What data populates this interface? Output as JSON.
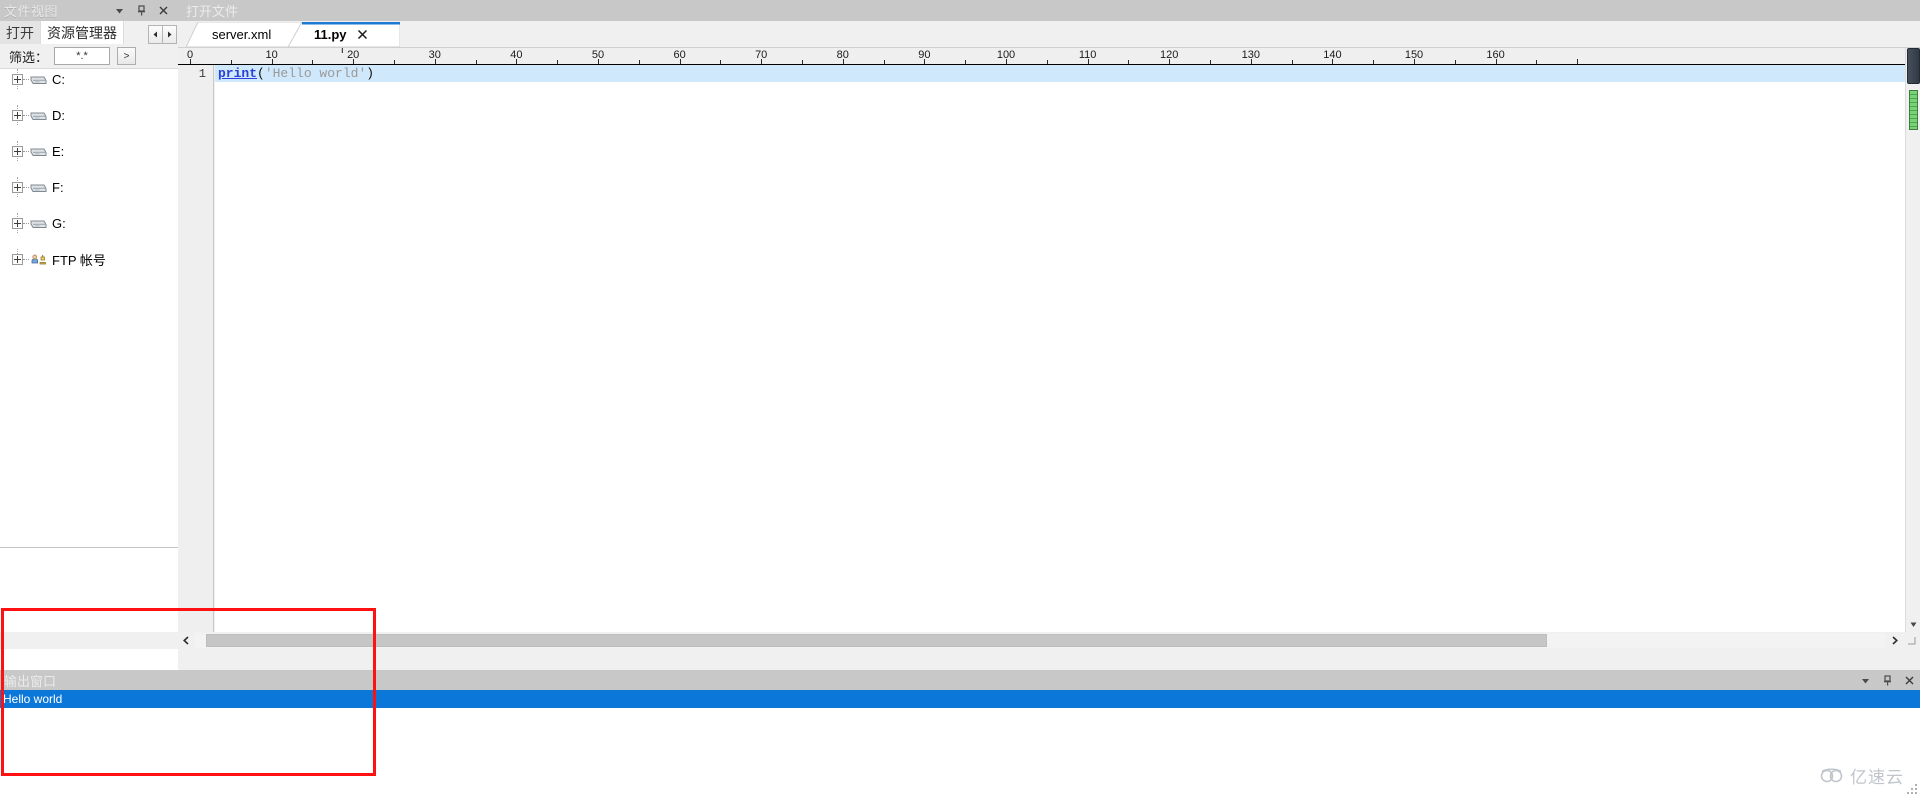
{
  "left_panel": {
    "caption": {
      "title": "文件视图",
      "buttons": [
        {
          "name": "dropdown",
          "label": "▾"
        },
        {
          "name": "pin",
          "label": "pin"
        },
        {
          "name": "close",
          "label": "✕"
        }
      ]
    },
    "tabs": [
      {
        "id": "open",
        "label": "打开",
        "active": false
      },
      {
        "id": "explorer",
        "label": "资源管理器",
        "active": true
      }
    ],
    "tab_nav": {
      "prev": "◄",
      "next": "►"
    },
    "filter": {
      "label": "筛选：",
      "value": "*.*",
      "placeholder": "*.*",
      "go_label": ">"
    },
    "tree": [
      {
        "label": "C:",
        "icon": "drive-icon",
        "expandable": true
      },
      {
        "label": "D:",
        "icon": "drive-icon",
        "expandable": true
      },
      {
        "label": "E:",
        "icon": "drive-icon",
        "expandable": true
      },
      {
        "label": "F:",
        "icon": "drive-icon",
        "expandable": true
      },
      {
        "label": "G:",
        "icon": "drive-icon",
        "expandable": true
      },
      {
        "label": "FTP 帐号",
        "icon": "ftp-account-icon",
        "expandable": true
      }
    ]
  },
  "editor": {
    "caption": {
      "title": "打开文件"
    },
    "tabs": [
      {
        "id": "server-xml",
        "label": "server.xml",
        "active": false,
        "closable": false
      },
      {
        "id": "11-py",
        "label": "11.py",
        "active": true,
        "closable": true,
        "close_label": "✕"
      }
    ],
    "ruler": {
      "labels": [
        "0",
        "10",
        "20",
        "30",
        "40",
        "50",
        "60",
        "70",
        "80",
        "90",
        "100",
        "110",
        "120",
        "130",
        "140",
        "150",
        "160"
      ],
      "tab_stop_marker": "T",
      "tab_stop_at": "20"
    },
    "gutter": {
      "line_numbers": [
        "1"
      ]
    },
    "code": {
      "lines": [
        {
          "number": "1",
          "selected": true,
          "tokens": [
            {
              "text": "print",
              "type": "keyword"
            },
            {
              "text": "(",
              "type": "punctuation"
            },
            {
              "text": "'Hello world'",
              "type": "string"
            },
            {
              "text": ")",
              "type": "punctuation"
            }
          ],
          "plain": "print('Hello world')"
        }
      ]
    },
    "scrollbars": {
      "vertical": {
        "up": "▲",
        "down": "▼"
      },
      "horizontal": {
        "left": "‹",
        "right": "›"
      }
    }
  },
  "output_panel": {
    "caption": {
      "title": "输出窗口",
      "buttons": [
        {
          "name": "dropdown",
          "label": "▾"
        },
        {
          "name": "pin",
          "label": "pin"
        },
        {
          "name": "close",
          "label": "✕"
        }
      ]
    },
    "lines": [
      {
        "text": "Hello world",
        "selected": true
      }
    ]
  },
  "watermark": {
    "text": "亿速云",
    "icon": "cloud-icon"
  },
  "colors": {
    "caption_bar": "#c8c8c8",
    "panel_bg": "#f0f0f0",
    "selection_blue": "#0b77d8",
    "code_line_highlight": "#cfe8fb",
    "keyword_blue": "#2b40d8",
    "string_gray": "#9a9a9a",
    "annotation_red": "#ff1111",
    "active_tab_accent": "#1e7ad0"
  }
}
